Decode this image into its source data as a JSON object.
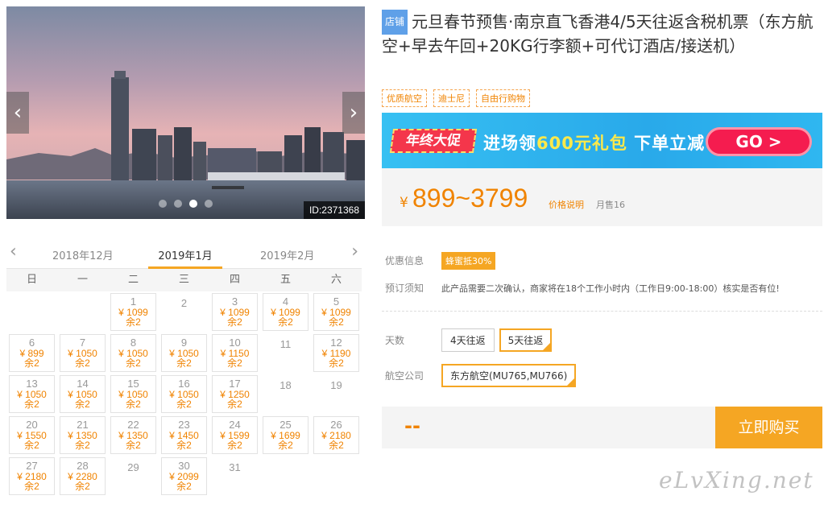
{
  "gallery": {
    "photo_id": "ID:2371368",
    "dot_count": 4,
    "active_dot": 2,
    "prev_icon": "chevron-left-icon",
    "next_icon": "chevron-right-icon"
  },
  "calendar": {
    "months": [
      "2018年12月",
      "2019年1月",
      "2019年2月"
    ],
    "active_month": "2019年1月",
    "weekdays": [
      "日",
      "一",
      "二",
      "三",
      "四",
      "五",
      "六"
    ],
    "lead_blank": 2,
    "days": [
      {
        "d": "1",
        "p": "¥ 1099",
        "s": "余2"
      },
      {
        "d": "2",
        "p": "",
        "s": ""
      },
      {
        "d": "3",
        "p": "¥ 1099",
        "s": "余2"
      },
      {
        "d": "4",
        "p": "¥ 1099",
        "s": "余2"
      },
      {
        "d": "5",
        "p": "¥ 1099",
        "s": "余2"
      },
      {
        "d": "6",
        "p": "¥ 899",
        "s": "余2"
      },
      {
        "d": "7",
        "p": "¥ 1050",
        "s": "余2"
      },
      {
        "d": "8",
        "p": "¥ 1050",
        "s": "余2"
      },
      {
        "d": "9",
        "p": "¥ 1050",
        "s": "余2"
      },
      {
        "d": "10",
        "p": "¥ 1150",
        "s": "余2"
      },
      {
        "d": "11",
        "p": "",
        "s": ""
      },
      {
        "d": "12",
        "p": "¥ 1190",
        "s": "余2"
      },
      {
        "d": "13",
        "p": "¥ 1050",
        "s": "余2"
      },
      {
        "d": "14",
        "p": "¥ 1050",
        "s": "余2"
      },
      {
        "d": "15",
        "p": "¥ 1050",
        "s": "余2"
      },
      {
        "d": "16",
        "p": "¥ 1050",
        "s": "余2"
      },
      {
        "d": "17",
        "p": "¥ 1250",
        "s": "余2"
      },
      {
        "d": "18",
        "p": "",
        "s": ""
      },
      {
        "d": "19",
        "p": "",
        "s": ""
      },
      {
        "d": "20",
        "p": "¥ 1550",
        "s": "余2"
      },
      {
        "d": "21",
        "p": "¥ 1350",
        "s": "余2"
      },
      {
        "d": "22",
        "p": "¥ 1350",
        "s": "余2"
      },
      {
        "d": "23",
        "p": "¥ 1450",
        "s": "余2"
      },
      {
        "d": "24",
        "p": "¥ 1599",
        "s": "余2"
      },
      {
        "d": "25",
        "p": "¥ 1699",
        "s": "余2"
      },
      {
        "d": "26",
        "p": "¥ 2180",
        "s": "余2"
      },
      {
        "d": "27",
        "p": "¥ 2180",
        "s": "余2"
      },
      {
        "d": "28",
        "p": "¥ 2280",
        "s": "余2"
      },
      {
        "d": "29",
        "p": "",
        "s": ""
      },
      {
        "d": "30",
        "p": "¥ 2099",
        "s": "余2"
      },
      {
        "d": "31",
        "p": "",
        "s": ""
      }
    ]
  },
  "product": {
    "shop_tag": "店铺",
    "title": "元旦春节预售·南京直飞香港4/5天往返含税机票（东方航空+早去午回+20KG行李额+可代订酒店/接送机）",
    "tags": [
      "优质航空",
      "迪士尼",
      "自由行购物"
    ]
  },
  "banner": {
    "badge": "年终大促",
    "text_pre": "进场领",
    "text_highlight": "600元礼包",
    "text_post": " 下单立减",
    "go_label": "GO >"
  },
  "price": {
    "currency": "¥",
    "range": "899~3799",
    "note": "价格说明",
    "sold": "月售16"
  },
  "info": {
    "promo_label": "优惠信息",
    "promo_badge": "蜂蜜抵30%",
    "notice_label": "预订须知",
    "notice_text": "此产品需要二次确认，商家将在18个工作小时内（工作日9:00-18:00）核实是否有位!"
  },
  "options": {
    "days_label": "天数",
    "days": [
      "4天往返",
      "5天往返"
    ],
    "days_selected": 1,
    "airline_label": "航空公司",
    "airlines": [
      "东方航空(MU765,MU766)"
    ],
    "airline_selected": 0
  },
  "purchase": {
    "total": "--",
    "buy_label": "立即购买"
  },
  "watermark": "eLvXing.net",
  "colors": {
    "accent": "#f5a623",
    "price": "#f08300",
    "shop_tag": "#5fa0e8",
    "banner_bg": "#2fb7f0",
    "banner_go": "#f51c4f"
  }
}
